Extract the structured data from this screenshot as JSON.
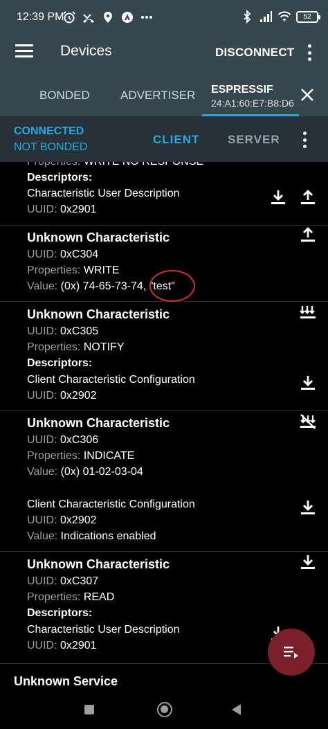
{
  "status_bar": {
    "time": "12:39 PM",
    "battery": "52",
    "left_icons": [
      "alarm-icon",
      "missed-call-icon",
      "location-icon",
      "autostart-icon",
      "more-dots-icon"
    ],
    "right_icons": [
      "bluetooth-icon",
      "cell-signal-icon",
      "wifi-icon",
      "battery-icon"
    ]
  },
  "app_bar": {
    "title": "Devices",
    "disconnect_label": "DISCONNECT"
  },
  "tabs": {
    "bonded": "BONDED",
    "advertiser": "ADVERTISER",
    "active_name": "ESPRESSIF",
    "active_address": "24:A1:60:E7:B8:D6"
  },
  "connection": {
    "state": "CONNECTED",
    "bond": "NOT BONDED",
    "client_tab": "CLIENT",
    "server_tab": "SERVER"
  },
  "accent_color": "#26a9e0",
  "content": {
    "top_partial": {
      "properties_label": "Properties:",
      "properties_value": "WRITE NO RESPONSE",
      "descriptors_label": "Descriptors:",
      "descriptor_name": "Characteristic User Description",
      "uuid_label": "UUID:",
      "uuid_value": "0x2901"
    },
    "characteristics": [
      {
        "title": "Unknown Characteristic",
        "uuid_label": "UUID:",
        "uuid": "0xC304",
        "properties_label": "Properties:",
        "properties": "WRITE",
        "value_label": "Value:",
        "value": "(0x) 74-65-73-74, \"test\""
      },
      {
        "title": "Unknown Characteristic",
        "uuid_label": "UUID:",
        "uuid": "0xC305",
        "properties_label": "Properties:",
        "properties": "NOTIFY",
        "descriptors_label": "Descriptors:",
        "descriptor_name": "Client Characteristic Configuration",
        "descriptor_uuid_label": "UUID:",
        "descriptor_uuid": "0x2902"
      },
      {
        "title": "Unknown Characteristic",
        "uuid_label": "UUID:",
        "uuid": "0xC306",
        "properties_label": "Properties:",
        "properties": "INDICATE",
        "value_label": "Value:",
        "value": "(0x) 01-02-03-04",
        "descriptor_name": "Client Characteristic Configuration",
        "descriptor_uuid_label": "UUID:",
        "descriptor_uuid": "0x2902",
        "descriptor_value_label": "Value:",
        "descriptor_value": "Indications enabled"
      },
      {
        "title": "Unknown Characteristic",
        "uuid_label": "UUID:",
        "uuid": "0xC307",
        "properties_label": "Properties:",
        "properties": "READ",
        "descriptors_label": "Descriptors:",
        "descriptor_name": "Characteristic User Description",
        "descriptor_uuid_label": "UUID:",
        "descriptor_uuid": "0x2901"
      }
    ]
  },
  "service": {
    "name": "Unknown Service"
  },
  "annotation_color": "#d32f2f",
  "fab_color": "#7b1f2b"
}
